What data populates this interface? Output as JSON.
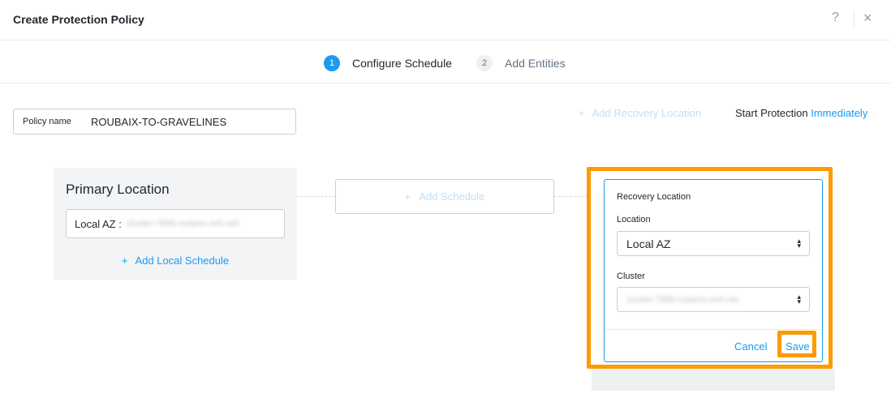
{
  "header": {
    "title": "Create Protection Policy",
    "help_icon": "?",
    "close_icon": "×"
  },
  "wizard": {
    "steps": [
      {
        "number": "1",
        "label": "Configure Schedule"
      },
      {
        "number": "2",
        "label": "Add Entities"
      }
    ]
  },
  "policy": {
    "label": "Policy name",
    "value": "ROUBAIX-TO-GRAVELINES"
  },
  "toolbar": {
    "add_recovery_label": "Add Recovery Location",
    "start_protection_label": "Start Protection",
    "start_protection_value": "Immediately"
  },
  "primary": {
    "title": "Primary Location",
    "az_label": "Local AZ :",
    "az_value_blurred": "cluster-7869.nutanix.ovh.net",
    "add_local_schedule": "Add Local Schedule"
  },
  "middle": {
    "add_schedule": "Add Schedule"
  },
  "recovery": {
    "title": "Recovery Location",
    "location_label": "Location",
    "location_value": "Local AZ",
    "cluster_label": "Cluster",
    "cluster_value_blurred": "cluster-7869.nutanix.ovh.net",
    "cancel": "Cancel",
    "save": "Save"
  },
  "colors": {
    "accent": "#1b9aee",
    "highlight": "#ff9a00",
    "disabled_link": "#bfe0f7"
  }
}
